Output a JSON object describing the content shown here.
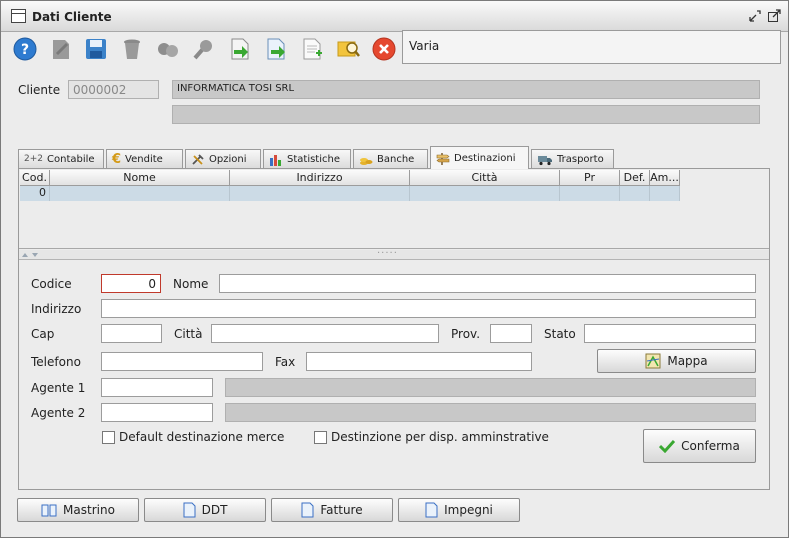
{
  "window": {
    "title": "Dati Cliente"
  },
  "toolbar": {
    "buttons": [
      {
        "icon": "help-icon"
      },
      {
        "icon": "edit-icon"
      },
      {
        "icon": "save-icon"
      },
      {
        "icon": "delete-icon"
      },
      {
        "icon": "link-icon"
      },
      {
        "icon": "search-icon"
      },
      {
        "icon": "export-icon"
      },
      {
        "icon": "import-icon"
      },
      {
        "icon": "new-document-icon"
      },
      {
        "icon": "user-search-icon"
      },
      {
        "icon": "close-icon"
      }
    ],
    "info_text": "Varia"
  },
  "cliente": {
    "label": "Cliente",
    "code": "0000002",
    "name": "INFORMATICA TOSI SRL",
    "extra": ""
  },
  "tabs": [
    {
      "label": "Contabile",
      "prefix": "2+2"
    },
    {
      "label": "Vendite"
    },
    {
      "label": "Opzioni"
    },
    {
      "label": "Statistiche"
    },
    {
      "label": "Banche"
    },
    {
      "label": "Destinazioni"
    },
    {
      "label": "Trasporto"
    }
  ],
  "grid": {
    "columns": [
      "Cod.",
      "Nome",
      "Indirizzo",
      "Città",
      "Pr",
      "Def.",
      "Am..."
    ],
    "rows": [
      [
        "0",
        "",
        "",
        "",
        "",
        "",
        ""
      ]
    ]
  },
  "form": {
    "codice_label": "Codice",
    "codice_value": "0",
    "nome_label": "Nome",
    "nome_value": "",
    "indirizzo_label": "Indirizzo",
    "indirizzo_value": "",
    "cap_label": "Cap",
    "cap_value": "",
    "citta_label": "Città",
    "citta_value": "",
    "prov_label": "Prov.",
    "prov_value": "",
    "stato_label": "Stato",
    "stato_value": "",
    "telefono_label": "Telefono",
    "telefono_value": "",
    "fax_label": "Fax",
    "fax_value": "",
    "mappa_label": "Mappa",
    "agente1_label": "Agente 1",
    "agente1_value": "",
    "agente1_desc": "",
    "agente2_label": "Agente 2",
    "agente2_value": "",
    "agente2_desc": "",
    "default_merce_label": "Default destinazione merce",
    "disp_amm_label": "Destinzione per disp. amminstrative",
    "conferma_label": "Conferma"
  },
  "bottom_buttons": [
    {
      "label": "Mastrino",
      "icon": "book-icon"
    },
    {
      "label": "DDT",
      "icon": "document-icon"
    },
    {
      "label": "Fatture",
      "icon": "document-icon"
    },
    {
      "label": "Impegni",
      "icon": "document-icon"
    }
  ],
  "colors": {
    "grid_row": "#ccdbe6",
    "readonly_field": "#c8c8c8",
    "error_border": "#c0392b"
  }
}
